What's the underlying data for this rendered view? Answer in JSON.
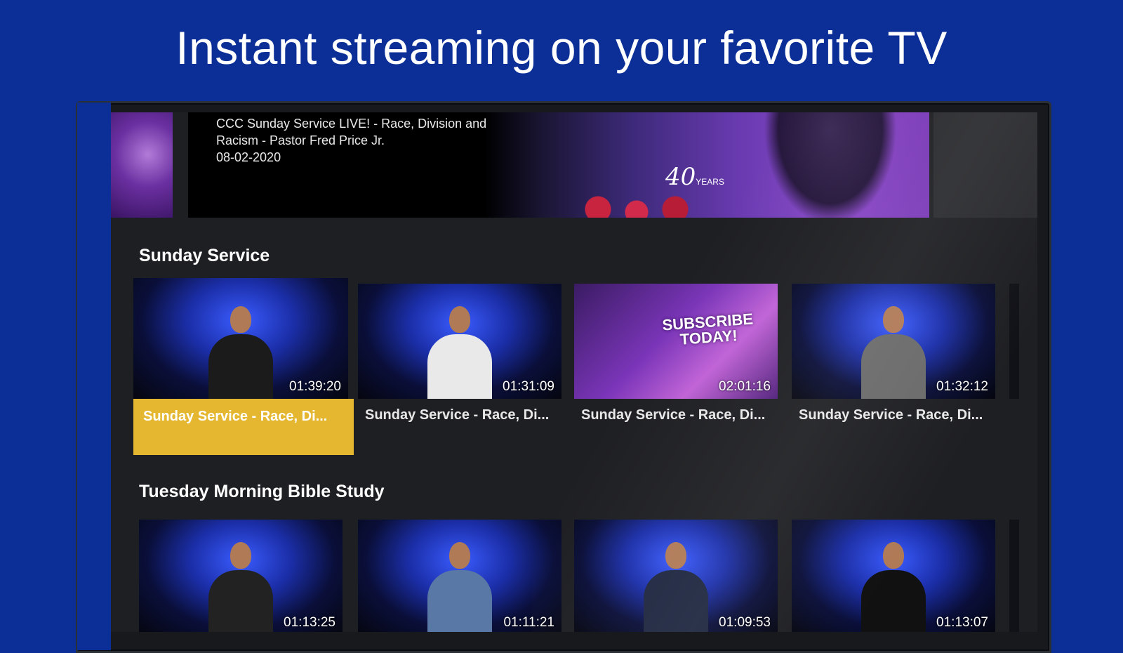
{
  "headline": "Instant streaming on your favorite TV",
  "colors": {
    "background": "#0b2f96",
    "focus_highlight": "#e5b731",
    "screen_bg": "#1e1f22"
  },
  "banner": {
    "title": "CCC Sunday Service LIVE! - Race, Division and Racism  - Pastor Fred Price Jr.",
    "date": "08-02-2020"
  },
  "rows": [
    {
      "title": "Sunday Service",
      "items": [
        {
          "title": "Sunday Service - Race, Di...",
          "duration": "01:39:20",
          "focused": true,
          "shirt": "#1b1b1b"
        },
        {
          "title": "Sunday Service - Race, Di...",
          "duration": "01:31:09",
          "focused": false,
          "shirt": "#e9e9e9"
        },
        {
          "title": "Sunday Service - Race, Di...",
          "duration": "02:01:16",
          "focused": false,
          "promo": "SUBSCRIBE TODAY!"
        },
        {
          "title": "Sunday Service - Race, Di...",
          "duration": "01:32:12",
          "focused": false,
          "shirt": "#6a6a6a"
        }
      ]
    },
    {
      "title": "Tuesday Morning Bible Study",
      "items": [
        {
          "duration": "01:13:25",
          "shirt": "#222222"
        },
        {
          "duration": "01:11:21",
          "shirt": "#5a78a6"
        },
        {
          "duration": "01:09:53",
          "shirt": "#1e2740"
        },
        {
          "duration": "01:13:07",
          "shirt": "#111111"
        }
      ]
    }
  ]
}
